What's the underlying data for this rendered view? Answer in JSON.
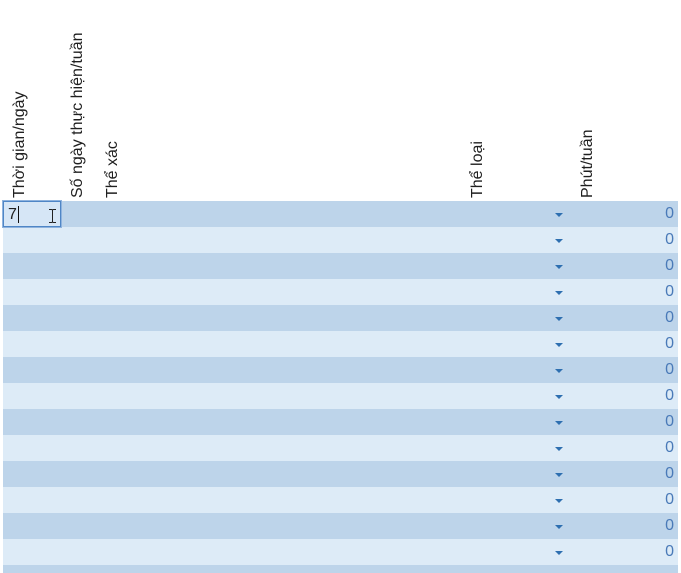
{
  "headers": {
    "col1": "Thời gian/ngày",
    "col2": "Số ngày thực hiện/tuần",
    "col3": "Thể xác",
    "col4": "Thể loại",
    "col5": "Phút/tuần"
  },
  "active_cell": {
    "value": "7"
  },
  "rows": [
    {
      "total": "0"
    },
    {
      "total": "0"
    },
    {
      "total": "0"
    },
    {
      "total": "0"
    },
    {
      "total": "0"
    },
    {
      "total": "0"
    },
    {
      "total": "0"
    },
    {
      "total": "0"
    },
    {
      "total": "0"
    },
    {
      "total": "0"
    },
    {
      "total": "0"
    },
    {
      "total": "0"
    },
    {
      "total": "0"
    },
    {
      "total": "0"
    }
  ],
  "icons": {
    "dropdown": "dropdown-arrow-icon",
    "cursor": "text-cursor-icon"
  },
  "colors": {
    "band_dark": "#bdd4ea",
    "band_light": "#ddebf7",
    "value_text": "#4a7ab8",
    "dropdown_arrow": "#2e6fb0"
  }
}
